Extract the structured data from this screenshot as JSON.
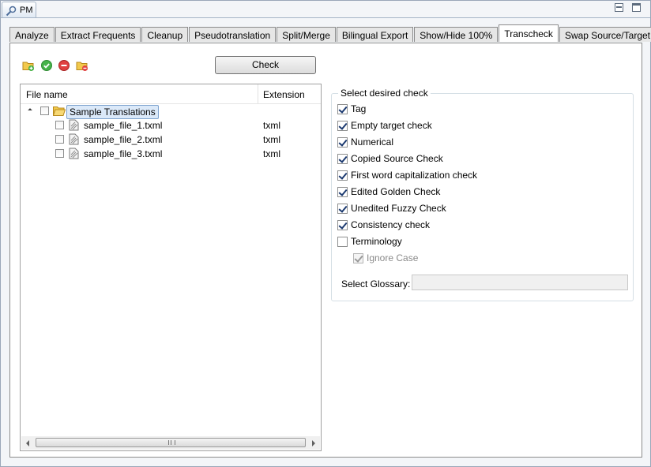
{
  "view": {
    "title": "PM"
  },
  "tabs": [
    {
      "label": "Analyze"
    },
    {
      "label": "Extract Frequents"
    },
    {
      "label": "Cleanup"
    },
    {
      "label": "Pseudotranslation"
    },
    {
      "label": "Split/Merge"
    },
    {
      "label": "Bilingual Export"
    },
    {
      "label": "Show/Hide 100%"
    },
    {
      "label": "Transcheck"
    },
    {
      "label": "Swap Source/Target"
    }
  ],
  "active_tab": "Transcheck",
  "toolbar": {
    "icons": [
      "add-folder-icon",
      "ok-icon",
      "remove-icon",
      "clear-folder-icon"
    ],
    "check_label": "Check"
  },
  "tree": {
    "col_filename": "File name",
    "col_extension": "Extension",
    "root": {
      "label": "Sample Translations",
      "checked": false
    },
    "files": [
      {
        "name": "sample_file_1.txml",
        "ext": "txml",
        "checked": false
      },
      {
        "name": "sample_file_2.txml",
        "ext": "txml",
        "checked": false
      },
      {
        "name": "sample_file_3.txml",
        "ext": "txml",
        "checked": false
      }
    ]
  },
  "checks": {
    "group_title": "Select desired check",
    "items": [
      {
        "label": "Tag",
        "checked": true,
        "enabled": true
      },
      {
        "label": "Empty target check",
        "checked": true,
        "enabled": true
      },
      {
        "label": "Numerical",
        "checked": true,
        "enabled": true
      },
      {
        "label": "Copied Source Check",
        "checked": true,
        "enabled": true
      },
      {
        "label": "First word capitalization check",
        "checked": true,
        "enabled": true
      },
      {
        "label": "Edited Golden Check",
        "checked": true,
        "enabled": true
      },
      {
        "label": "Unedited Fuzzy Check",
        "checked": true,
        "enabled": true
      },
      {
        "label": "Consistency check",
        "checked": true,
        "enabled": true
      },
      {
        "label": "Terminology",
        "checked": false,
        "enabled": true
      },
      {
        "label": "Ignore Case",
        "checked": true,
        "enabled": false
      }
    ],
    "glossary_label": "Select Glossary:",
    "glossary_value": ""
  }
}
